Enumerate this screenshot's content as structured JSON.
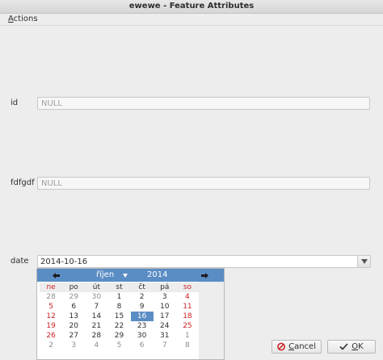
{
  "window": {
    "title": "ewewe - Feature Attributes"
  },
  "menu": {
    "actions_label": "Actions"
  },
  "fields": [
    {
      "label": "id",
      "placeholder": "NULL"
    },
    {
      "label": "fdfgdf",
      "placeholder": "NULL"
    }
  ],
  "date_field": {
    "label": "date",
    "value": "2014-10-16"
  },
  "calendar": {
    "month": "říjen",
    "year": "2014",
    "weekdays": [
      "ne",
      "po",
      "út",
      "st",
      "čt",
      "pá",
      "so"
    ],
    "weeks": [
      [
        "28",
        "29",
        "30",
        "1",
        "2",
        "3",
        "4"
      ],
      [
        "5",
        "6",
        "7",
        "8",
        "9",
        "10",
        "11"
      ],
      [
        "12",
        "13",
        "14",
        "15",
        "16",
        "17",
        "18"
      ],
      [
        "19",
        "20",
        "21",
        "22",
        "23",
        "24",
        "25"
      ],
      [
        "26",
        "27",
        "28",
        "29",
        "30",
        "31",
        "1"
      ],
      [
        "2",
        "3",
        "4",
        "5",
        "6",
        "7",
        "8"
      ]
    ],
    "selected_day": "16",
    "colors": {
      "header": "#5b8dc5",
      "weekend": "#cc2222",
      "dimmed": "#8e8e8e"
    }
  },
  "buttons": {
    "cancel_label": "Cancel",
    "ok_label": "OK"
  }
}
